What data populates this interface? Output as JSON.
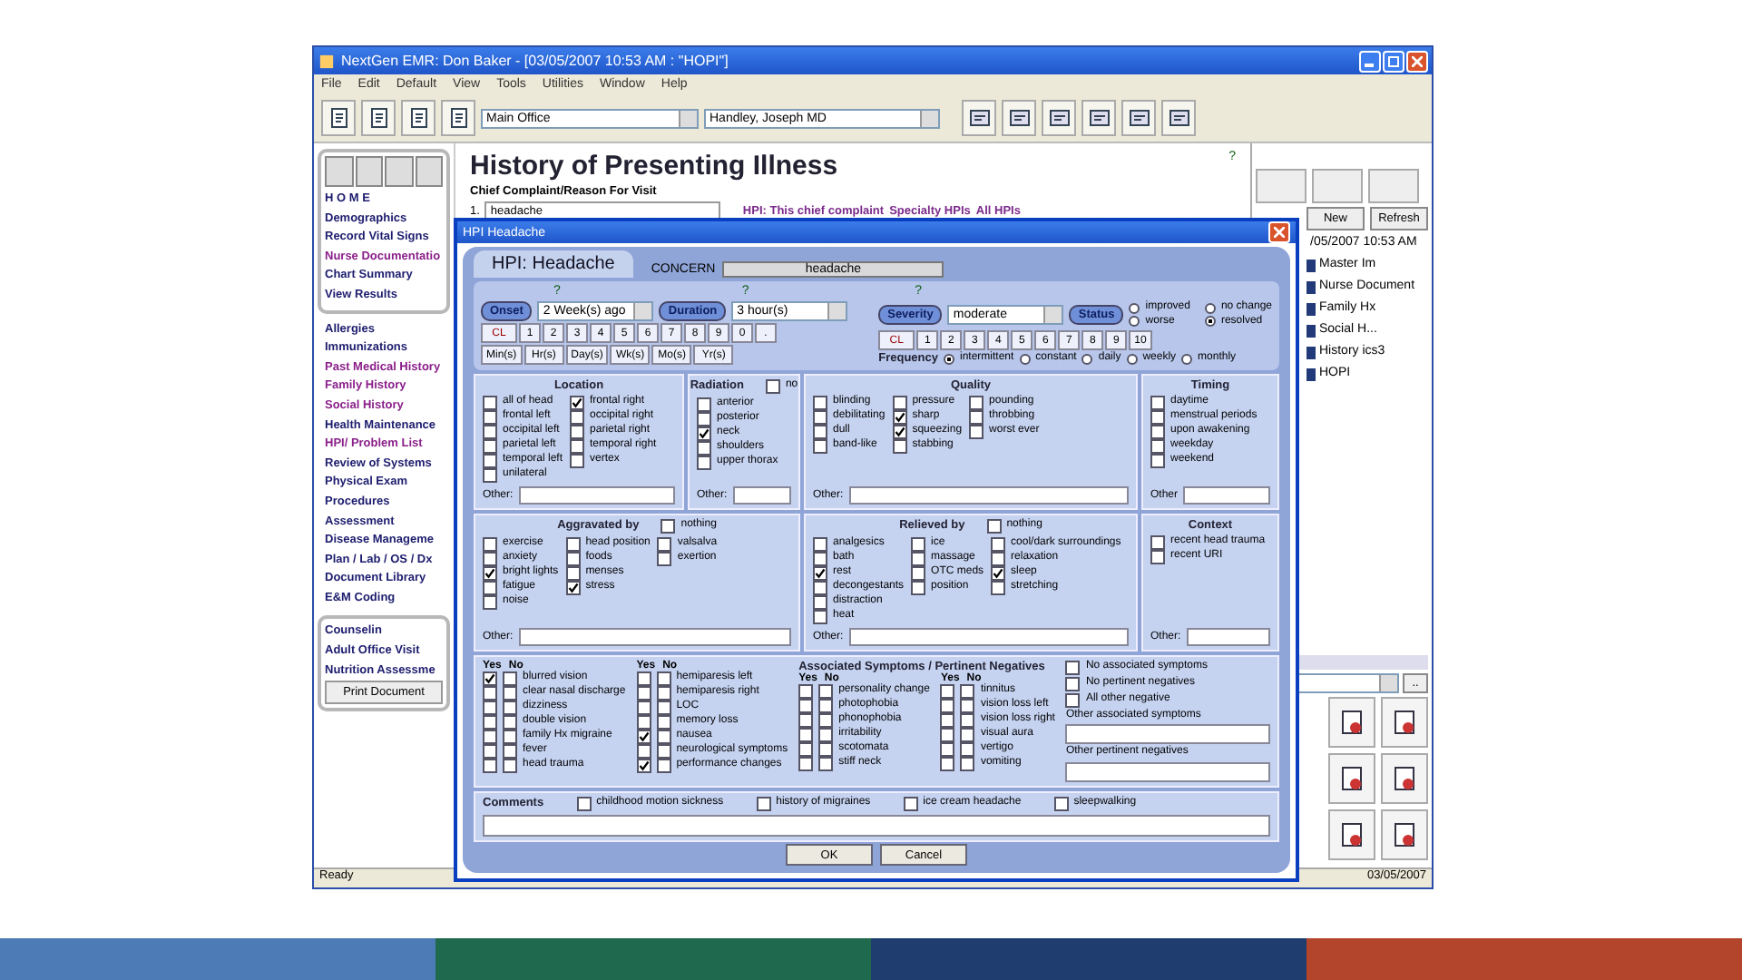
{
  "window": {
    "title": "NextGen EMR: Don Baker - [03/05/2007 10:53 AM : \"HOPI\"]"
  },
  "menu": [
    "File",
    "Edit",
    "Default",
    "View",
    "Tools",
    "Utilities",
    "Window",
    "Help"
  ],
  "location_selects": [
    "Main Office",
    "Handley, Joseph MD"
  ],
  "nav": {
    "groups": [
      [
        {
          "label": "H O M E",
          "color": "#1c1c6e"
        },
        {
          "label": "Demographics",
          "color": "#1c1c6e"
        },
        {
          "label": "Record Vital Signs",
          "color": "#1c1c6e"
        },
        {
          "label": "Nurse Documentatio",
          "color": "#8a1f8a"
        },
        {
          "label": "Chart Summary",
          "color": "#1c1c6e"
        },
        {
          "label": "View Results",
          "color": "#1c1c6e"
        }
      ],
      [
        {
          "label": "Allergies",
          "color": "#1c1c6e"
        },
        {
          "label": "Immunizations",
          "color": "#1c1c6e"
        },
        {
          "label": "Past Medical History",
          "color": "#8a1f8a"
        },
        {
          "label": "Family History",
          "color": "#8a1f8a"
        },
        {
          "label": "Social History",
          "color": "#8a1f8a"
        },
        {
          "label": "Health Maintenance",
          "color": "#1c1c6e"
        },
        {
          "label": "HPI/ Problem List",
          "color": "#8a1f8a"
        },
        {
          "label": "Review of Systems",
          "color": "#1c1c6e"
        },
        {
          "label": "Physical Exam",
          "color": "#1c1c6e"
        },
        {
          "label": "Procedures",
          "color": "#1c1c6e"
        },
        {
          "label": "Assessment",
          "color": "#1c1c6e"
        },
        {
          "label": "Disease Manageme",
          "color": "#1c1c6e"
        },
        {
          "label": "Plan / Lab / OS / Dx",
          "color": "#1c1c6e"
        },
        {
          "label": "Document Library",
          "color": "#1c1c6e"
        },
        {
          "label": "E&M Coding",
          "color": "#1c1c6e"
        }
      ],
      [
        {
          "label": "Counselin",
          "color": "#1c1c6e"
        },
        {
          "label": "Adult Office Visit",
          "color": "#1c1c6e"
        },
        {
          "label": "Nutrition Assessme",
          "color": "#1c1c6e"
        }
      ]
    ],
    "print_button": "Print Document"
  },
  "page": {
    "title": "History of Presenting Illness",
    "help": "?",
    "subtitle": "Chief Complaint/Reason For Visit",
    "number": "1.",
    "complaint": "headache",
    "links": [
      "HPI: This chief complaint",
      "Specialty HPIs",
      "All HPIs"
    ]
  },
  "right_panel": {
    "buttons": [
      "New",
      "Refresh"
    ],
    "items": [
      "/05/2007 10:53 AM",
      "Master Im",
      "Nurse Document",
      "Family Hx",
      "Social H...",
      "History ics3",
      "HOPI"
    ],
    "more_button": ".."
  },
  "status_bar": {
    "left": "Ready",
    "right": "03/05/2007"
  },
  "dialog": {
    "title": "HPI Headache",
    "heading": "HPI: Headache",
    "concern_label": "CONCERN",
    "concern": "headache",
    "onset": {
      "help": "?",
      "label": "Onset",
      "value": "2 Week(s) ago"
    },
    "duration": {
      "help": "?",
      "label": "Duration",
      "value": "3 hour(s)"
    },
    "keypad": [
      "CL",
      "1",
      "2",
      "3",
      "4",
      "5",
      "6",
      "7",
      "8",
      "9",
      "0",
      "."
    ],
    "units": [
      "Min(s)",
      "Hr(s)",
      "Day(s)",
      "Wk(s)",
      "Mo(s)",
      "Yr(s)"
    ],
    "severity": {
      "help": "?",
      "label": "Severity",
      "value": "moderate",
      "keypad": [
        "CL",
        "1",
        "2",
        "3",
        "4",
        "5",
        "6",
        "7",
        "8",
        "9",
        "10"
      ]
    },
    "status": {
      "label": "Status",
      "options": [
        {
          "label": "improved",
          "selected": false
        },
        {
          "label": "worse",
          "selected": false
        },
        {
          "label": "no change",
          "selected": false
        },
        {
          "label": "resolved",
          "selected": true
        }
      ]
    },
    "frequency": {
      "label": "Frequency",
      "options": [
        {
          "label": "intermittent",
          "selected": true
        },
        {
          "label": "constant",
          "selected": false
        },
        {
          "label": "daily",
          "selected": false
        },
        {
          "label": "weekly",
          "selected": false
        },
        {
          "label": "monthly",
          "selected": false
        }
      ]
    },
    "sections": [
      {
        "title": "Location",
        "other": "Other:",
        "columns": [
          [
            {
              "label": "all of head",
              "checked": false
            },
            {
              "label": "frontal left",
              "checked": false
            },
            {
              "label": "occipital left",
              "checked": false
            },
            {
              "label": "parietal left",
              "checked": false
            },
            {
              "label": "temporal left",
              "checked": false
            },
            {
              "label": "unilateral",
              "checked": false
            }
          ],
          [
            {
              "label": "frontal right",
              "checked": true
            },
            {
              "label": "occipital right",
              "checked": false
            },
            {
              "label": "parietal right",
              "checked": false
            },
            {
              "label": "temporal right",
              "checked": false
            },
            {
              "label": "vertex",
              "checked": false
            }
          ]
        ]
      },
      {
        "title": "Radiation",
        "other": "Other:",
        "none": {
          "label": "no",
          "checked": false
        },
        "columns": [
          [
            {
              "label": "anterior",
              "checked": false
            },
            {
              "label": "posterior",
              "checked": false
            },
            {
              "label": "neck",
              "checked": true
            },
            {
              "label": "shoulders",
              "checked": false
            },
            {
              "label": "upper thorax",
              "checked": false
            }
          ]
        ]
      },
      {
        "title": "Quality",
        "other": "Other:",
        "columns": [
          [
            {
              "label": "blinding",
              "checked": false
            },
            {
              "label": "debilitating",
              "checked": false
            },
            {
              "label": "dull",
              "checked": false
            },
            {
              "label": "band-like",
              "checked": false
            }
          ],
          [
            {
              "label": "pressure",
              "checked": false
            },
            {
              "label": "sharp",
              "checked": true
            },
            {
              "label": "squeezing",
              "checked": true
            },
            {
              "label": "stabbing",
              "checked": false
            }
          ],
          [
            {
              "label": "pounding",
              "checked": false
            },
            {
              "label": "throbbing",
              "checked": false
            },
            {
              "label": "worst ever",
              "checked": false
            }
          ]
        ]
      },
      {
        "title": "Timing",
        "other": "Other",
        "columns": [
          [
            {
              "label": "daytime",
              "checked": false
            },
            {
              "label": "menstrual periods",
              "checked": false
            },
            {
              "label": "upon awakening",
              "checked": false
            },
            {
              "label": "weekday",
              "checked": false
            },
            {
              "label": "weekend",
              "checked": false
            }
          ]
        ]
      },
      {
        "title": "Aggravated by",
        "other": "Other:",
        "none": {
          "label": "nothing",
          "checked": false
        },
        "columns": [
          [
            {
              "label": "exercise",
              "checked": false
            },
            {
              "label": "anxiety",
              "checked": false
            },
            {
              "label": "bright lights",
              "checked": true
            },
            {
              "label": "fatigue",
              "checked": false
            },
            {
              "label": "noise",
              "checked": false
            }
          ],
          [
            {
              "label": "head position",
              "checked": false
            },
            {
              "label": "foods",
              "checked": false
            },
            {
              "label": "menses",
              "checked": false
            },
            {
              "label": "stress",
              "checked": true
            }
          ],
          [
            {
              "label": "valsalva",
              "checked": false
            },
            {
              "label": "exertion",
              "checked": false
            }
          ]
        ]
      },
      {
        "title": "Relieved by",
        "other": "Other:",
        "none": {
          "label": "nothing",
          "checked": false
        },
        "columns": [
          [
            {
              "label": "analgesics",
              "checked": false
            },
            {
              "label": "bath",
              "checked": false
            },
            {
              "label": "rest",
              "checked": true
            },
            {
              "label": "decongestants",
              "checked": false
            },
            {
              "label": "distraction",
              "checked": false
            },
            {
              "label": "heat",
              "checked": false
            }
          ],
          [
            {
              "label": "ice",
              "checked": false
            },
            {
              "label": "massage",
              "checked": false
            },
            {
              "label": "OTC meds",
              "checked": false
            },
            {
              "label": "position",
              "checked": false
            }
          ],
          [
            {
              "label": "cool/dark surroundings",
              "checked": false
            },
            {
              "label": "relaxation",
              "checked": false
            },
            {
              "label": "sleep",
              "checked": true
            },
            {
              "label": "stretching",
              "checked": false
            }
          ]
        ]
      },
      {
        "title": "Context",
        "other": "Other:",
        "columns": [
          [
            {
              "label": "recent head trauma",
              "checked": false
            },
            {
              "label": "recent URI",
              "checked": false
            }
          ]
        ]
      }
    ],
    "associated": {
      "title": "Associated Symptoms / Pertinent Negatives",
      "columns": [
        {
          "yes_label": "Yes",
          "no_label": "No",
          "items": [
            {
              "label": "blurred vision",
              "yes": true,
              "no": false
            },
            {
              "label": "clear nasal discharge",
              "yes": false,
              "no": false
            },
            {
              "label": "dizziness",
              "yes": false,
              "no": false
            },
            {
              "label": "double vision",
              "yes": false,
              "no": false
            },
            {
              "label": "family Hx migraine",
              "yes": false,
              "no": false
            },
            {
              "label": "fever",
              "yes": false,
              "no": false
            },
            {
              "label": "head trauma",
              "yes": false,
              "no": false
            }
          ]
        },
        {
          "yes_label": "Yes",
          "no_label": "No",
          "items": [
            {
              "label": "hemiparesis left",
              "yes": false,
              "no": false
            },
            {
              "label": "hemiparesis right",
              "yes": false,
              "no": false
            },
            {
              "label": "LOC",
              "yes": false,
              "no": false
            },
            {
              "label": "memory loss",
              "yes": false,
              "no": false
            },
            {
              "label": "nausea",
              "yes": true,
              "no": false
            },
            {
              "label": "neurological symptoms",
              "yes": false,
              "no": false
            },
            {
              "label": "performance changes",
              "yes": true,
              "no": false
            }
          ]
        },
        {
          "yes_label": "Yes",
          "no_label": "No",
          "items": [
            {
              "label": "personality change",
              "yes": false,
              "no": false
            },
            {
              "label": "photophobia",
              "yes": false,
              "no": false
            },
            {
              "label": "phonophobia",
              "yes": false,
              "no": false
            },
            {
              "label": "irritability",
              "yes": false,
              "no": false
            },
            {
              "label": "scotomata",
              "yes": false,
              "no": false
            },
            {
              "label": "stiff neck",
              "yes": false,
              "no": false
            }
          ]
        },
        {
          "yes_label": "Yes",
          "no_label": "No",
          "items": [
            {
              "label": "tinnitus",
              "yes": false,
              "no": false
            },
            {
              "label": "vision loss left",
              "yes": false,
              "no": false
            },
            {
              "label": "vision loss right",
              "yes": false,
              "no": false
            },
            {
              "label": "visual aura",
              "yes": false,
              "no": false
            },
            {
              "label": "vertigo",
              "yes": false,
              "no": false
            },
            {
              "label": "vomiting",
              "yes": false,
              "no": false
            }
          ]
        }
      ],
      "summary": [
        {
          "label": "No associated symptoms",
          "checked": false
        },
        {
          "label": "No pertinent negatives",
          "checked": false
        },
        {
          "label": "All other negative",
          "checked": false
        }
      ],
      "other_fields": [
        "Other associated symptoms",
        "Other pertinent negatives"
      ]
    },
    "comments": {
      "label": "Comments",
      "options": [
        {
          "label": "childhood motion sickness",
          "checked": false
        },
        {
          "label": "history of migraines",
          "checked": false
        },
        {
          "label": "ice cream headache",
          "checked": false
        },
        {
          "label": "sleepwalking",
          "checked": false
        }
      ]
    },
    "buttons": [
      "OK",
      "Cancel"
    ]
  }
}
